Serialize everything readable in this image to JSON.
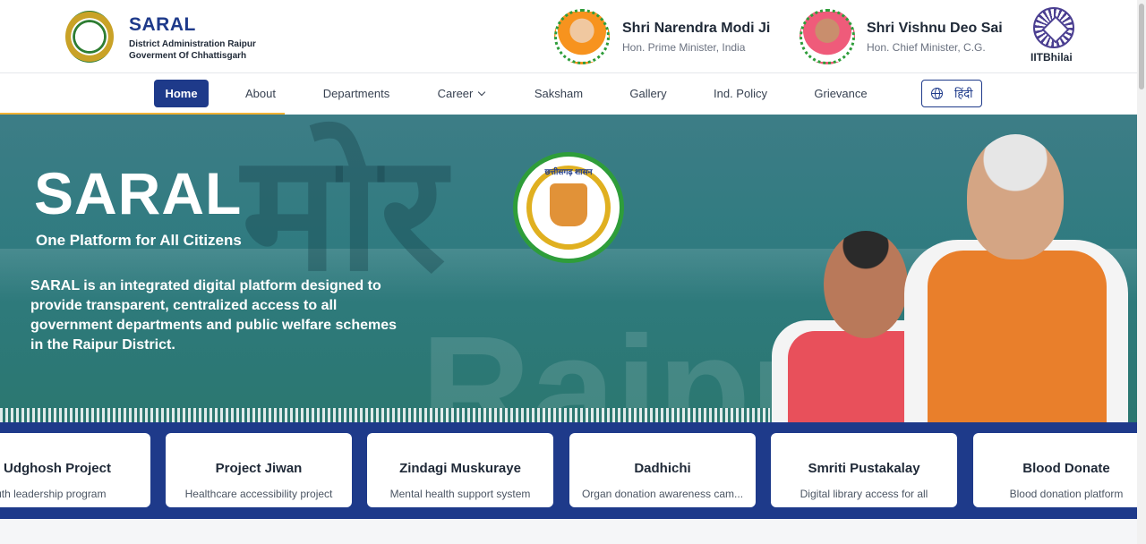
{
  "header": {
    "brand_title": "SARAL",
    "brand_sub1": "District Administration Raipur",
    "brand_sub2": "Goverment Of Chhattisgarh",
    "leaders": [
      {
        "name": "Shri Narendra Modi Ji",
        "role": "Hon. Prime Minister, India"
      },
      {
        "name": "Shri Vishnu Deo Sai",
        "role": "Hon. Chief Minister, C.G."
      }
    ],
    "partner_label": "IITBhilai"
  },
  "nav": {
    "items": [
      {
        "label": "Home",
        "active": true
      },
      {
        "label": "About"
      },
      {
        "label": "Departments"
      },
      {
        "label": "Career",
        "dropdown": true
      },
      {
        "label": "Saksham"
      },
      {
        "label": "Gallery"
      },
      {
        "label": "Ind. Policy"
      },
      {
        "label": "Grievance"
      }
    ],
    "language_label": "हिंदी",
    "scroll_progress_percent": 25
  },
  "hero": {
    "title": "SARAL",
    "tagline": "One Platform for All Citizens",
    "description": "SARAL is an integrated digital platform designed to provide transparent, centralized access to all government departments and public welfare schemes in the Raipur District.",
    "emblem_text": "छत्तीसगढ़ शासन",
    "background_word": "मोर",
    "background_word2": "Raipur"
  },
  "projects": [
    {
      "title": "Udghosh Project",
      "desc": "Youth leadership program"
    },
    {
      "title": "Project Jiwan",
      "desc": "Healthcare accessibility project"
    },
    {
      "title": "Zindagi Muskuraye",
      "desc": "Mental health support system"
    },
    {
      "title": "Dadhichi",
      "desc": "Organ donation awareness cam..."
    },
    {
      "title": "Smriti Pustakalay",
      "desc": "Digital library access for all"
    },
    {
      "title": "Blood Donate",
      "desc": "Blood donation platform"
    }
  ],
  "colors": {
    "primary": "#1e3a8a",
    "accent": "#f2b233",
    "hero_teal": "#2f7b80"
  }
}
